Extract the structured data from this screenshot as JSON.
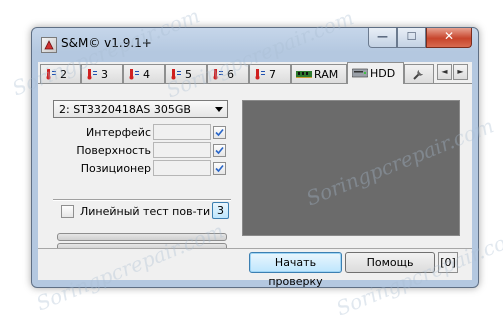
{
  "window": {
    "title": "S&M© v1.9.1+",
    "controls": {
      "minimize": "—",
      "maximize": "☐",
      "close": "✕"
    }
  },
  "tabs": [
    {
      "label": "2",
      "icon": "temperature-icon"
    },
    {
      "label": "3",
      "icon": "temperature-icon"
    },
    {
      "label": "4",
      "icon": "temperature-icon"
    },
    {
      "label": "5",
      "icon": "temperature-icon"
    },
    {
      "label": "6",
      "icon": "temperature-icon"
    },
    {
      "label": "7",
      "icon": "temperature-icon"
    },
    {
      "label": "RAM",
      "icon": "ram-icon"
    },
    {
      "label": "HDD",
      "icon": "hdd-icon",
      "active": true
    },
    {
      "label": "",
      "icon": "tools-icon"
    }
  ],
  "tab_scroll": {
    "left": "◄",
    "right": "►"
  },
  "hdd": {
    "drive_select": "2:  ST3320418AS   305GB",
    "fields": [
      {
        "label": "Интерфейс",
        "value": "",
        "checked": true
      },
      {
        "label": "Поверхность",
        "value": "",
        "checked": true
      },
      {
        "label": "Позиционер",
        "value": "",
        "checked": true
      }
    ],
    "linear_test": {
      "label": "Линейный тест пов-ти",
      "checked": false,
      "count": "3"
    },
    "progress": [
      0,
      0
    ]
  },
  "footer": {
    "start_button": "Начать проверку",
    "help_button": "Помощь",
    "counter": "[0]"
  },
  "watermark": "Soringpcrepair.com",
  "colors": {
    "graph_bg": "#6b6b6b",
    "check_color": "#2a66c8",
    "temp_icon_red": "#d02020"
  }
}
